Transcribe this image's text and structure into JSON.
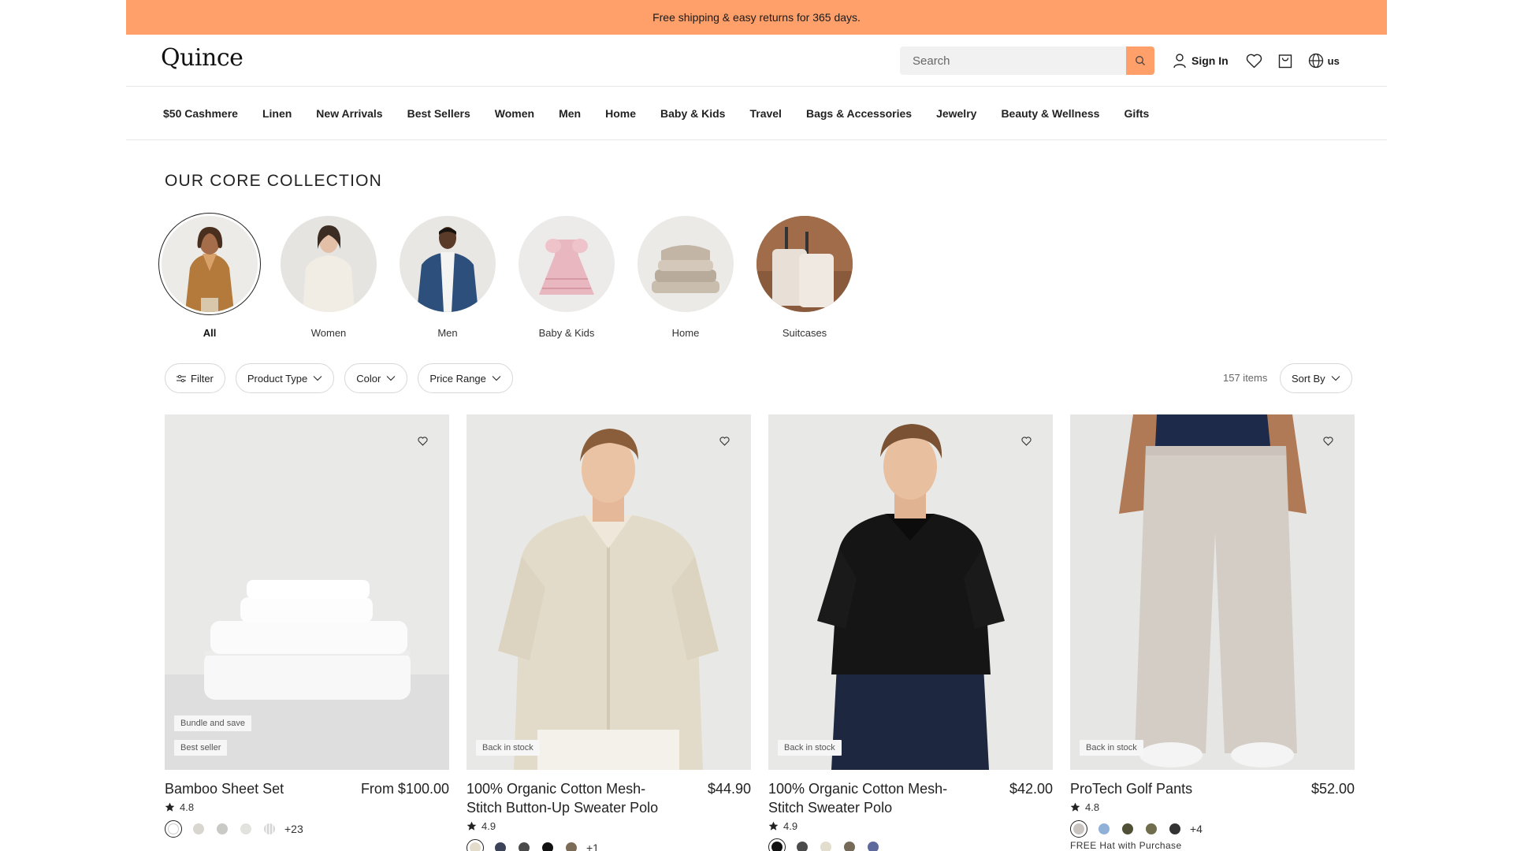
{
  "promo": {
    "text": "Free shipping & easy returns for 365 days."
  },
  "header": {
    "logo": "Quince",
    "search_placeholder": "Search",
    "sign_in": "Sign In",
    "locale": "us",
    "accent_color": "#ff9f6a"
  },
  "nav": {
    "items": [
      "$50 Cashmere",
      "Linen",
      "New Arrivals",
      "Best Sellers",
      "Women",
      "Men",
      "Home",
      "Baby & Kids",
      "Travel",
      "Bags & Accessories",
      "Jewelry",
      "Beauty & Wellness",
      "Gifts"
    ]
  },
  "collection": {
    "title": "OUR CORE COLLECTION",
    "categories": [
      {
        "label": "All",
        "selected": true
      },
      {
        "label": "Women",
        "selected": false
      },
      {
        "label": "Men",
        "selected": false
      },
      {
        "label": "Baby & Kids",
        "selected": false
      },
      {
        "label": "Home",
        "selected": false
      },
      {
        "label": "Suitcases",
        "selected": false
      }
    ]
  },
  "filters": {
    "filter": "Filter",
    "product_type": "Product Type",
    "color": "Color",
    "price_range": "Price Range",
    "items_count": "157 items",
    "sort_by": "Sort By"
  },
  "products": [
    {
      "name": "Bamboo Sheet Set",
      "price": "From $100.00",
      "rating": "4.8",
      "badges": [
        "Bundle and save",
        "Best seller"
      ],
      "swatches": [
        "#ffffff",
        "#d9d6cf",
        "#c9c9c6",
        "#e2e2df",
        "#d4d4d4"
      ],
      "more": "+23",
      "extra": ""
    },
    {
      "name": "100% Organic Cotton Mesh-Stitch Button-Up Sweater Polo",
      "price": "$44.90",
      "rating": "4.9",
      "badges": [
        "Back in stock"
      ],
      "swatches": [
        "#e4dccb",
        "#3c4258",
        "#4a4a4a",
        "#111111",
        "#7b6c58"
      ],
      "more": "+1",
      "extra": ""
    },
    {
      "name": "100% Organic Cotton Mesh-Stitch Sweater Polo",
      "price": "$42.00",
      "rating": "4.9",
      "badges": [
        "Back in stock"
      ],
      "swatches": [
        "#111111",
        "#4b4b4b",
        "#e3ddce",
        "#756b58",
        "#5e6a9c"
      ],
      "more": "",
      "extra": ""
    },
    {
      "name": "ProTech Golf Pants",
      "price": "$52.00",
      "rating": "4.8",
      "badges": [
        "Back in stock"
      ],
      "swatches": [
        "#c9c4bf",
        "#8fb1d8",
        "#4f5035",
        "#6f6d4c",
        "#333333"
      ],
      "more": "+4",
      "extra": "FREE Hat with Purchase"
    }
  ]
}
